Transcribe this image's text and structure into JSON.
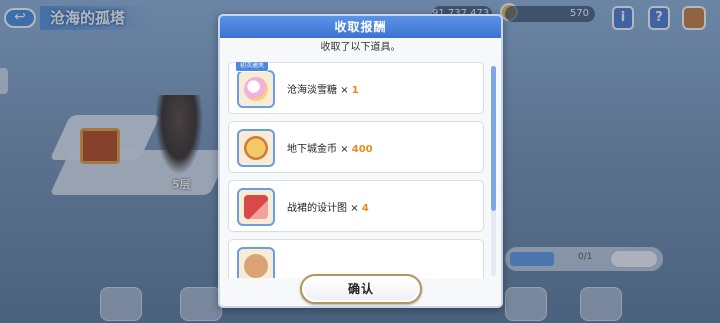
{
  "background": {
    "area_title": "沧海的孤塔",
    "resource_1_value": "91,737,473",
    "resource_2_value": "570",
    "floor_label": "5层",
    "right_panel_count": "0/1"
  },
  "modal": {
    "title": "收取报酬",
    "subtitle": "收取了以下道具。",
    "items": [
      {
        "name": "沧海淡雪糖",
        "mult": "×",
        "qty": "1",
        "badge": "初次通关",
        "icon": "candy-icon"
      },
      {
        "name": "地下城金币",
        "mult": "×",
        "qty": "400",
        "badge": "",
        "icon": "coin-icon"
      },
      {
        "name": "战裙的设计图",
        "mult": "×",
        "qty": "4",
        "badge": "",
        "icon": "design-icon"
      },
      {
        "name": "",
        "mult": "",
        "qty": "",
        "badge": "",
        "icon": "item-icon"
      }
    ],
    "confirm_label": "确认"
  },
  "colors": {
    "header": "#3c73d0",
    "qty": "#e88a1a",
    "icon_border": "#6d9de0"
  }
}
